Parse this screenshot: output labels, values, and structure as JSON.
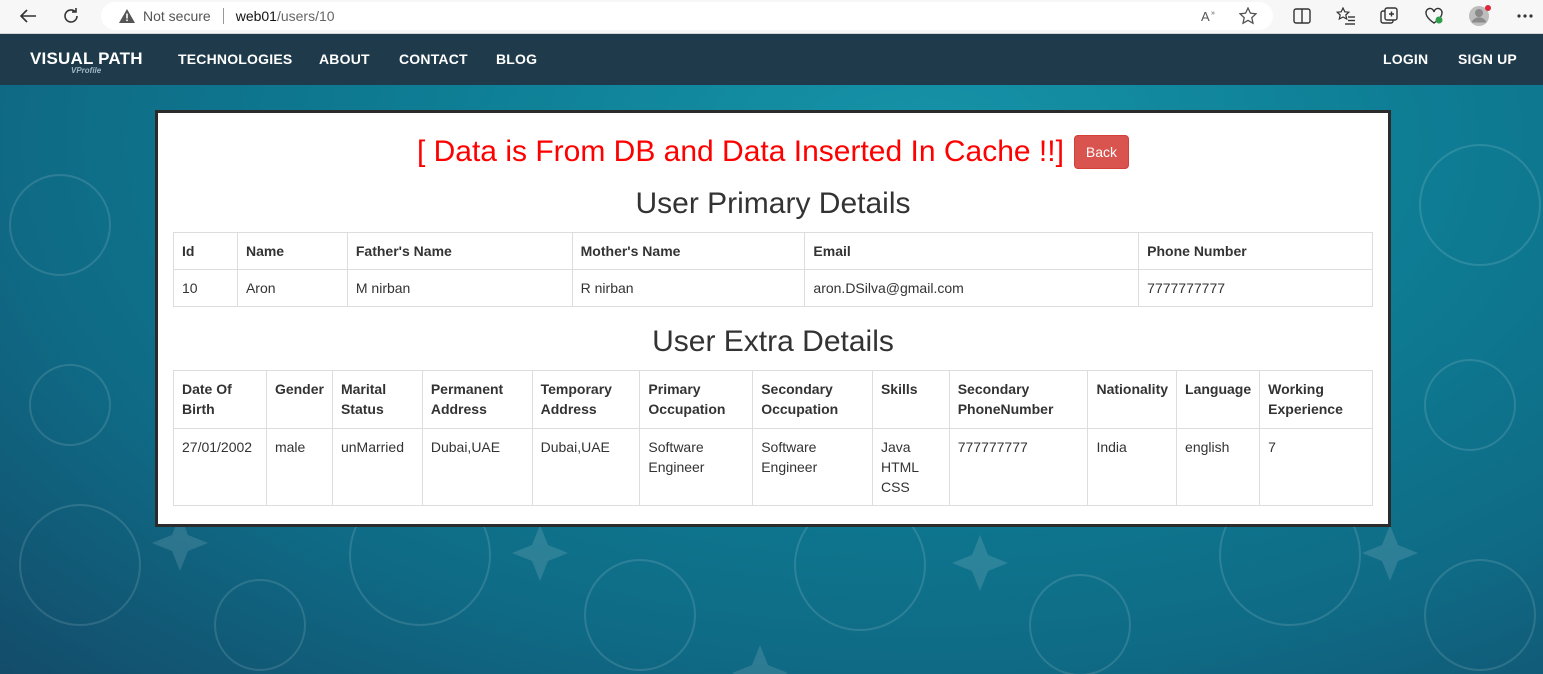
{
  "browser": {
    "security_label": "Not secure",
    "url_host": "web01",
    "url_path": "/users/10"
  },
  "nav": {
    "brand": "VISUAL PATH",
    "brand_sub": "VProfile",
    "links": [
      "TECHNOLOGIES",
      "ABOUT",
      "CONTACT",
      "BLOG"
    ],
    "login": "LOGIN",
    "signup": "SIGN UP"
  },
  "status_message": "[ Data is From DB and Data Inserted In Cache !!]",
  "back_label": "Back",
  "primary": {
    "title": "User Primary Details",
    "headers": [
      "Id",
      "Name",
      "Father's Name",
      "Mother's Name",
      "Email",
      "Phone Number"
    ],
    "row": [
      "10",
      "Aron",
      "M nirban",
      "R nirban",
      "aron.DSilva@gmail.com",
      "7777777777"
    ]
  },
  "extra": {
    "title": "User Extra Details",
    "headers": [
      "Date Of Birth",
      "Gender",
      "Marital Status",
      "Permanent Address",
      "Temporary Address",
      "Primary Occupation",
      "Secondary Occupation",
      "Skills",
      "Secondary PhoneNumber",
      "Nationality",
      "Language",
      "Working Experience"
    ],
    "row": [
      "27/01/2002",
      "male",
      "unMarried",
      "Dubai,UAE",
      "Dubai,UAE",
      "Software Engineer",
      "Software Engineer",
      "Java HTML CSS",
      "777777777",
      "India",
      "english",
      "7"
    ]
  },
  "colors": {
    "navbar": "#1f3a4a",
    "status_text": "#ff0000",
    "back_button": "#d9534f",
    "background": "#0e7f96"
  }
}
